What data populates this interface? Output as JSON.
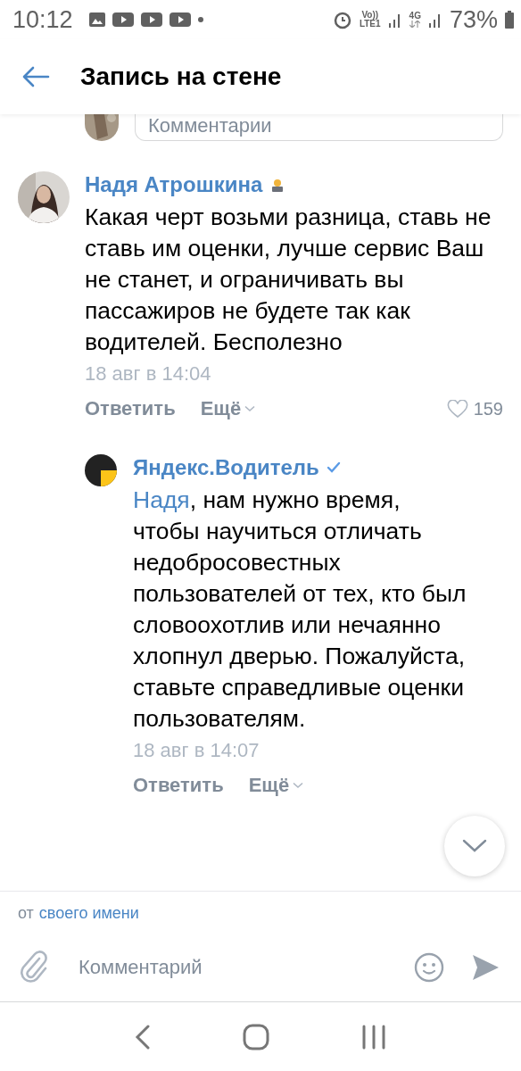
{
  "status_bar": {
    "time": "10:12",
    "volte": "Vo))",
    "lte": "LTE1",
    "network": "4G",
    "battery": "73%"
  },
  "header": {
    "title": "Запись на стене"
  },
  "top_comment_field": {
    "placeholder": "Комментарии"
  },
  "comments": [
    {
      "author": "Надя Атрошкина",
      "verified": false,
      "text": "Какая черт возьми разница, ставь не ставь им оценки, лучше сервис Ваш не станет, и ограничивать вы пассажиров не будете так как водителей. Бесполезно",
      "date": "18 авг в 14:04",
      "reply": "Ответить",
      "more": "Ещё",
      "likes": "159",
      "replies": [
        {
          "author": "Яндекс.Водитель",
          "verified": true,
          "mention": "Надя",
          "text": ", нам нужно время, чтобы научиться отличать недобросовестных пользователей от тех, кто был словоохотлив или нечаянно хлопнул дверью. Пожалуйста, ставьте справедливые оценки пользователям.",
          "date": "18 авг в 14:07",
          "reply": "Ответить",
          "more": "Ещё"
        }
      ]
    }
  ],
  "composer": {
    "from_prefix": "от",
    "from_link": "своего имени",
    "placeholder": "Комментарий"
  }
}
